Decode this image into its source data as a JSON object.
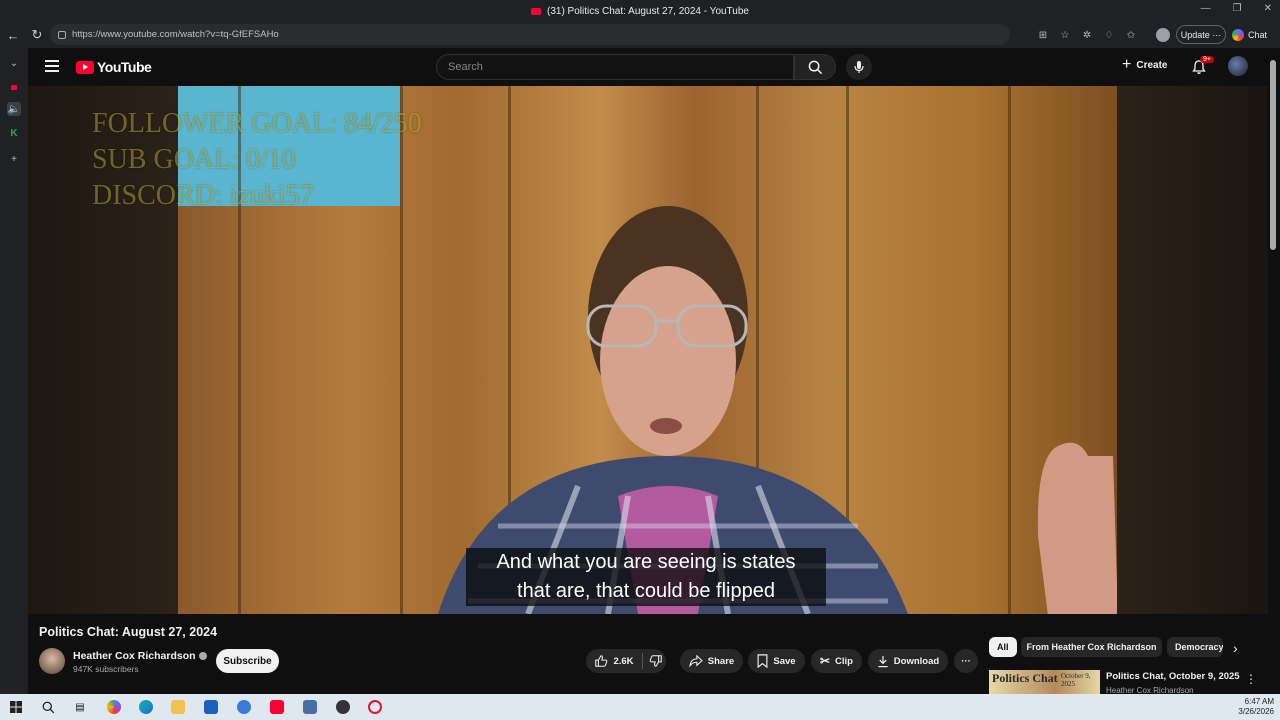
{
  "browser": {
    "tab_title": "(31) Politics Chat: August 27, 2024 - YouTube",
    "url": "https://www.youtube.com/watch?v=tq-GfEFSAHo",
    "update_label": "Update",
    "chat_label": "Chat"
  },
  "youtube": {
    "logo_text": "YouTube",
    "search_placeholder": "Search",
    "create_label": "Create",
    "notification_badge": "9+"
  },
  "video": {
    "overlay_lines": [
      "FOLLOWER GOAL:  84/250",
      "SUB GOAL: 0/10",
      "DISCORD: izuki57"
    ],
    "caption_lines": [
      "And what you are seeing is states",
      "that are, that could be flipped"
    ],
    "title": "Politics Chat: August 27, 2024"
  },
  "channel": {
    "name": "Heather Cox Richardson",
    "subscribers": "947K subscribers",
    "subscribe_label": "Subscribe"
  },
  "actions": {
    "likes": "2.6K",
    "share": "Share",
    "save": "Save",
    "clip": "Clip",
    "download": "Download"
  },
  "chips": [
    "All",
    "From Heather Cox Richardson",
    "Democracy"
  ],
  "recommendation": {
    "thumb_word": "Politics Chat",
    "thumb_date": "October 9, 2025",
    "title": "Politics Chat, October 9, 2025",
    "channel": "Heather Cox Richardson"
  },
  "taskbar": {
    "time": "6:47 AM",
    "date": "3/26/2026"
  },
  "colors": {
    "youtube_red": "#ff0033",
    "background": "#0f0f0f",
    "pill": "#272727"
  }
}
